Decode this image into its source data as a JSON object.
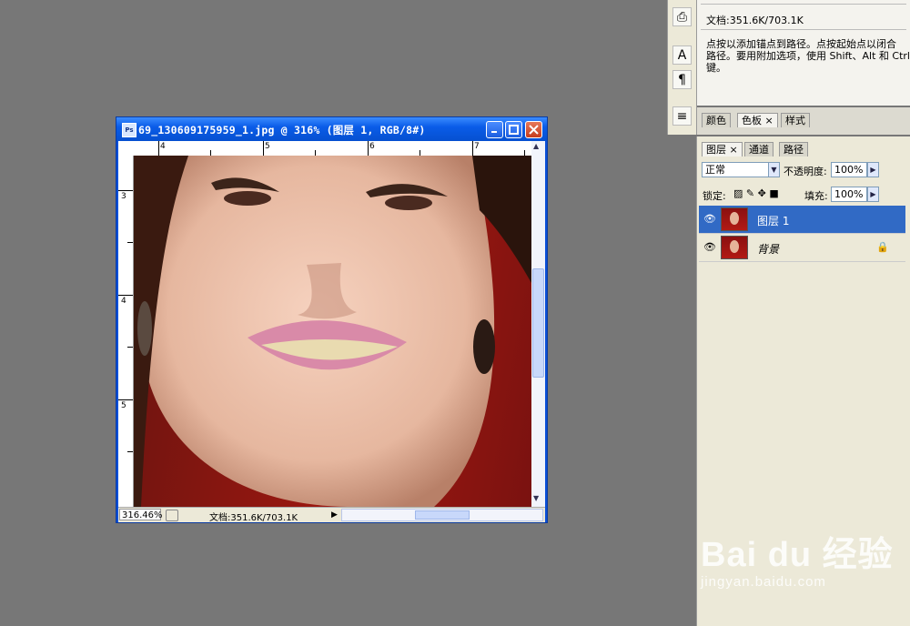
{
  "document_window": {
    "title": "69_130609175959_1.jpg @ 316% (图层 1, RGB/8#)",
    "ps_icon": "Ps",
    "zoom": "316.46%",
    "doc_info": "文档:351.6K/703.1K",
    "ruler_top": [
      "4",
      "5",
      "6",
      "7"
    ],
    "ruler_left": [
      "3",
      "4",
      "5"
    ]
  },
  "info_panel": {
    "doc_size": "文档:351.6K/703.1K",
    "hint_lines": [
      "点按以添加锚点到路径。点按起始点以闭合",
      "路径。要用附加选项，使用 Shift、Alt 和 Ctrl",
      "键。"
    ]
  },
  "color_panel": {
    "tabs": [
      "颜色",
      "色板 ×",
      "样式"
    ]
  },
  "layers_panel": {
    "tabs": [
      "图层 ×",
      "通道",
      "路径"
    ],
    "blend_mode": "正常",
    "opacity_label": "不透明度:",
    "opacity_value": "100%",
    "lock_label": "锁定:",
    "fill_label": "填充:",
    "fill_value": "100%",
    "layers": [
      {
        "name": "图层 1",
        "selected": true
      },
      {
        "name": "背景",
        "selected": false
      }
    ]
  },
  "watermark": {
    "brand": "Bai du 经验",
    "url": "jingyan.baidu.com"
  },
  "colors": {
    "workspace": "#777777",
    "title_blue": "#0a5ce8",
    "selection": "#316ac5"
  }
}
